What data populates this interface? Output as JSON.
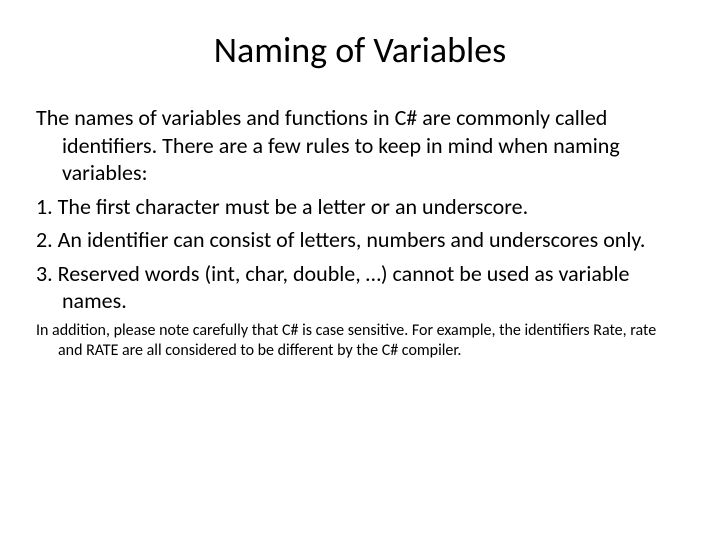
{
  "title": "Naming of Variables",
  "intro": "The names of variables and functions in C# are commonly called identifiers. There are a few rules to keep in mind when naming variables:",
  "rules": [
    "1. The first character must be a letter or an underscore.",
    "2. An identifier can consist of letters, numbers and underscores only.",
    "3. Reserved words (int, char, double, …) cannot be used as variable names."
  ],
  "note": "In addition, please note carefully that C# is case sensitive. For example, the identifiers Rate, rate and RATE are all considered to be different by the C# compiler."
}
